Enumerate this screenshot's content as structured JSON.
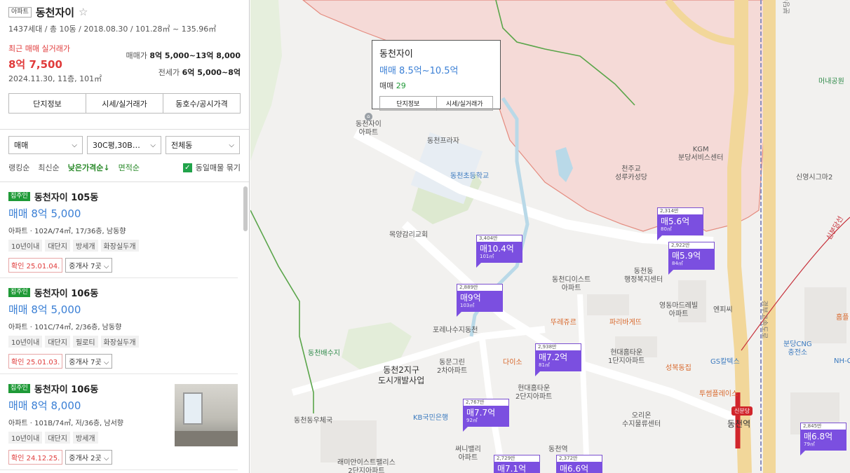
{
  "complex": {
    "type_badge": "아파트",
    "name": "동천자이",
    "star_icon": "☆",
    "summary": "1437세대 / 총 10동 / 2018.08.30 / 101.28㎡ ~ 135.96㎡",
    "recent_label": "최근 매매 실거래가",
    "recent_price": "8억 7,500",
    "recent_detail": "2024.11.30, 11층, 101㎡",
    "sale_label": "매매가",
    "sale_range": "8억 5,000~13억 8,000",
    "rent_label": "전세가",
    "rent_range": "6억 5,000~8억"
  },
  "tabs": [
    "단지정보",
    "시세/실거래가",
    "동호수/공시가격"
  ],
  "filters": {
    "trade": "매매",
    "area": "30C평,30B…",
    "dong": "전체동"
  },
  "sort": {
    "ranking": "랭킹순",
    "latest": "최신순",
    "low_price": "낮은가격순↓",
    "area": "면적순",
    "same_listing": "동일매물 묶기",
    "same_checked": "✓"
  },
  "listings": [
    {
      "badge": "집주인",
      "name": "동천자이 105동",
      "price": "매매 8억 5,000",
      "desc": "아파트 · 102A/74㎡, 17/36층, 남동향",
      "tags": [
        "10년이내",
        "대단지",
        "방세개",
        "화장실두개"
      ],
      "confirm": "확인 25.01.04.",
      "agents": "중개사 7곳 ⌵"
    },
    {
      "badge": "집주인",
      "name": "동천자이 106동",
      "price": "매매 8억 5,000",
      "desc": "아파트 · 101C/74㎡, 2/36층, 남동향",
      "tags": [
        "10년이내",
        "대단지",
        "필로티",
        "화장실두개"
      ],
      "confirm": "확인 25.01.03.",
      "agents": "중개사 7곳 ⌵"
    },
    {
      "badge": "집주인",
      "name": "동천자이 106동",
      "price": "매매 8억 8,000",
      "desc": "아파트 · 101B/74㎡, 저/36층, 남서향",
      "tags": [
        "10년이내",
        "대단지",
        "방세개"
      ],
      "confirm": "확인 24.12.25.",
      "agents": "중개사 2곳 ⌵"
    }
  ],
  "popup": {
    "title": "동천자이",
    "range": "매매 8.5억~10.5억",
    "count_label": "매매",
    "count": "29",
    "tabs": [
      "단지정보",
      "시세/실거래가"
    ]
  },
  "markers": [
    {
      "count": "3,404만",
      "price": "매10.4억",
      "area": "101㎡"
    },
    {
      "count": "2,889만",
      "price": "매9억",
      "area": "103㎡"
    },
    {
      "count": "2,314만",
      "price": "매5.6억",
      "area": "80㎡"
    },
    {
      "count": "2,922만",
      "price": "매5.9억",
      "area": "84㎡"
    },
    {
      "count": "2,938만",
      "price": "매7.2억",
      "area": "81㎡"
    },
    {
      "count": "2,767만",
      "price": "매7.7억",
      "area": "92㎡"
    },
    {
      "count": "2,845만",
      "price": "매6.8억",
      "area": "79㎡"
    },
    {
      "count": "2,729만",
      "price": "매7.1억",
      "area": ""
    },
    {
      "count": "2,372만",
      "price": "매6.6억",
      "area": ""
    }
  ],
  "pois": {
    "dongcheon_xi": "동천자이\n아파트",
    "dongcheon_plaza": "동천프라자",
    "school": "동천초등학교",
    "church": "목양감리교회",
    "dongcheon_center": "동천디이스트\n아파트",
    "admin": "동천동\n행정복지센터",
    "forena": "포레나수지동천",
    "baesuji": "동천배수지",
    "dongmun": "동문그린\n2차아파트",
    "daiso": "다이소",
    "district": "동천2지구\n도시개발사업",
    "hyundai2": "현대홈타운\n2단지아파트",
    "hyundai1": "현대홈타운\n1단지아파트",
    "kb": "KB국민은행",
    "ssuni": "써니밸리\n아파트",
    "raemian": "래미안이스트팰리스\n2단지아파트",
    "dongcheon_station_apt": "동천역",
    "orion": "오리온\n수지물류센터",
    "toureju": "뚜레쥬르",
    "paris": "파리바게뜨",
    "yeongdeok": "영동마드레빌\n아파트",
    "kgm": "KGM\n분당서비스센터",
    "cheonju": "천주교\n성루카성당",
    "sinyeong": "신영시그마2",
    "meonae": "머내공원",
    "seongbok": "성복동집",
    "gs": "GS칼텍스",
    "cng": "분당CNG\n충전소",
    "twosome": "투썸플레이스",
    "station": "동천역",
    "line_badge": "신분당",
    "expressway": "경부고속도로",
    "ent": "엔피씨",
    "homeplus": "홈플",
    "nh": "NH-C",
    "raemian1": "래미안이스트팰리스",
    "dongbu": "동천동우체국",
    "sinbundang": "신분당선",
    "sujiroad": "분당수서간도시고속"
  }
}
